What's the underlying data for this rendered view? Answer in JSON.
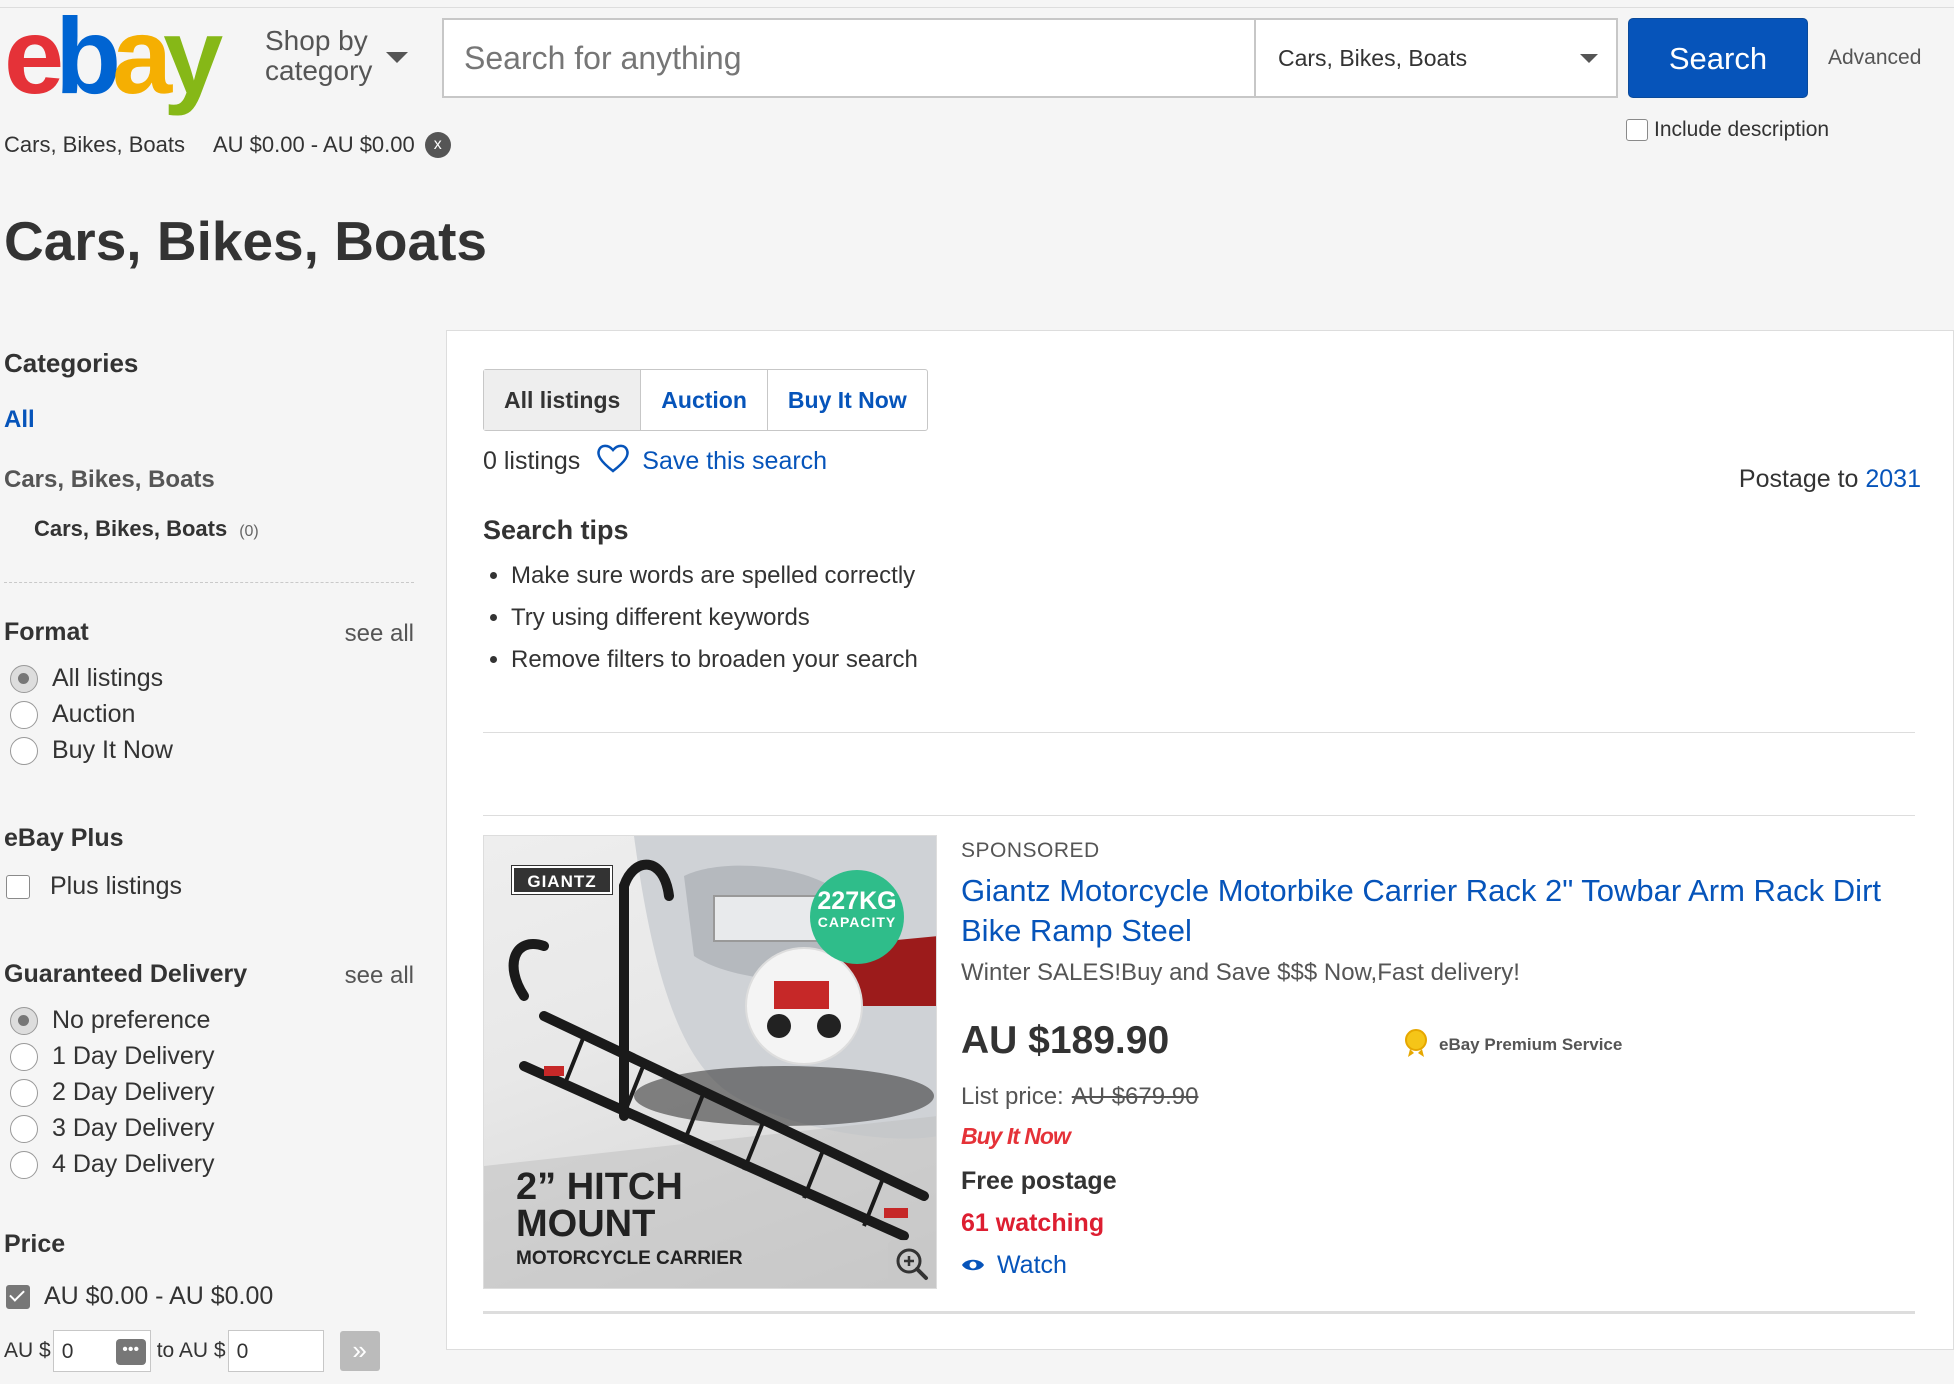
{
  "header": {
    "logo_text": "ebay",
    "shop_by_line1": "Shop by",
    "shop_by_line2": "category",
    "search_placeholder": "Search for anything",
    "search_value": "",
    "category_selected": "Cars, Bikes, Boats",
    "search_button": "Search",
    "advanced_link": "Advanced",
    "include_description": "Include description"
  },
  "breadcrumb": {
    "category": "Cars, Bikes, Boats",
    "price_filter": "AU $0.00 - AU $0.00",
    "clear_symbol": "x"
  },
  "page_title": "Cars, Bikes, Boats",
  "sidebar": {
    "categories_heading": "Categories",
    "all_link": "All",
    "parent_category": "Cars, Bikes, Boats",
    "child_category": "Cars, Bikes, Boats",
    "child_count": "(0)",
    "format": {
      "heading": "Format",
      "see_all": "see all",
      "options": [
        "All listings",
        "Auction",
        "Buy It Now"
      ],
      "selected": "All listings"
    },
    "ebay_plus": {
      "heading": "eBay Plus",
      "option": "Plus listings"
    },
    "delivery": {
      "heading": "Guaranteed Delivery",
      "see_all": "see all",
      "options": [
        "No preference",
        "1 Day Delivery",
        "2 Day Delivery",
        "3 Day Delivery",
        "4 Day Delivery"
      ],
      "selected": "No preference"
    },
    "price": {
      "heading": "Price",
      "checked_range": "AU $0.00 - AU $0.00",
      "from_label": "AU $",
      "from_value": "0",
      "to_label": "to AU $",
      "to_value": "0"
    }
  },
  "main": {
    "tabs": [
      {
        "label": "All listings",
        "active": true
      },
      {
        "label": "Auction",
        "active": false
      },
      {
        "label": "Buy It Now",
        "active": false
      }
    ],
    "listing_count": "0 listings",
    "save_search": "Save this search",
    "postage_label": "Postage to",
    "postage_zip": "2031",
    "search_tips_heading": "Search tips",
    "search_tips": [
      "Make sure words are spelled correctly",
      "Try using different keywords",
      "Remove filters to broaden your search"
    ]
  },
  "product": {
    "sponsored": "SPONSORED",
    "title": "Giantz Motorcycle Motorbike Carrier Rack 2\" Towbar Arm Rack Dirt Bike Ramp Steel",
    "subtitle": "Winter SALES!Buy and Save $$$ Now,Fast delivery!",
    "price": "AU $189.90",
    "premium_service": "eBay Premium Service",
    "list_price_label": "List price:",
    "list_price": "AU $679.90",
    "buy_it_now_badge": "Buy It Now",
    "shipping": "Free postage",
    "watching": "61 watching",
    "watch_link": "Watch",
    "image": {
      "brand_tag": "GIANTZ",
      "capacity_number": "227KG",
      "capacity_text": "CAPACITY",
      "caption_line1": "2” HITCH",
      "caption_line2": "MOUNT",
      "caption_line3": "MOTORCYCLE CARRIER"
    }
  },
  "colors": {
    "ebay_red": "#e53238",
    "ebay_blue": "#0064d2",
    "ebay_yellow": "#f5af02",
    "ebay_green": "#86b817",
    "link_blue": "#0654ba",
    "watching_red": "#dd1e31"
  },
  "icons": [
    "chevron-down-icon",
    "close-icon",
    "heart-icon",
    "eye-icon",
    "zoom-icon",
    "double-chevron-right-icon",
    "more-dots-icon",
    "premium-badge-icon"
  ]
}
